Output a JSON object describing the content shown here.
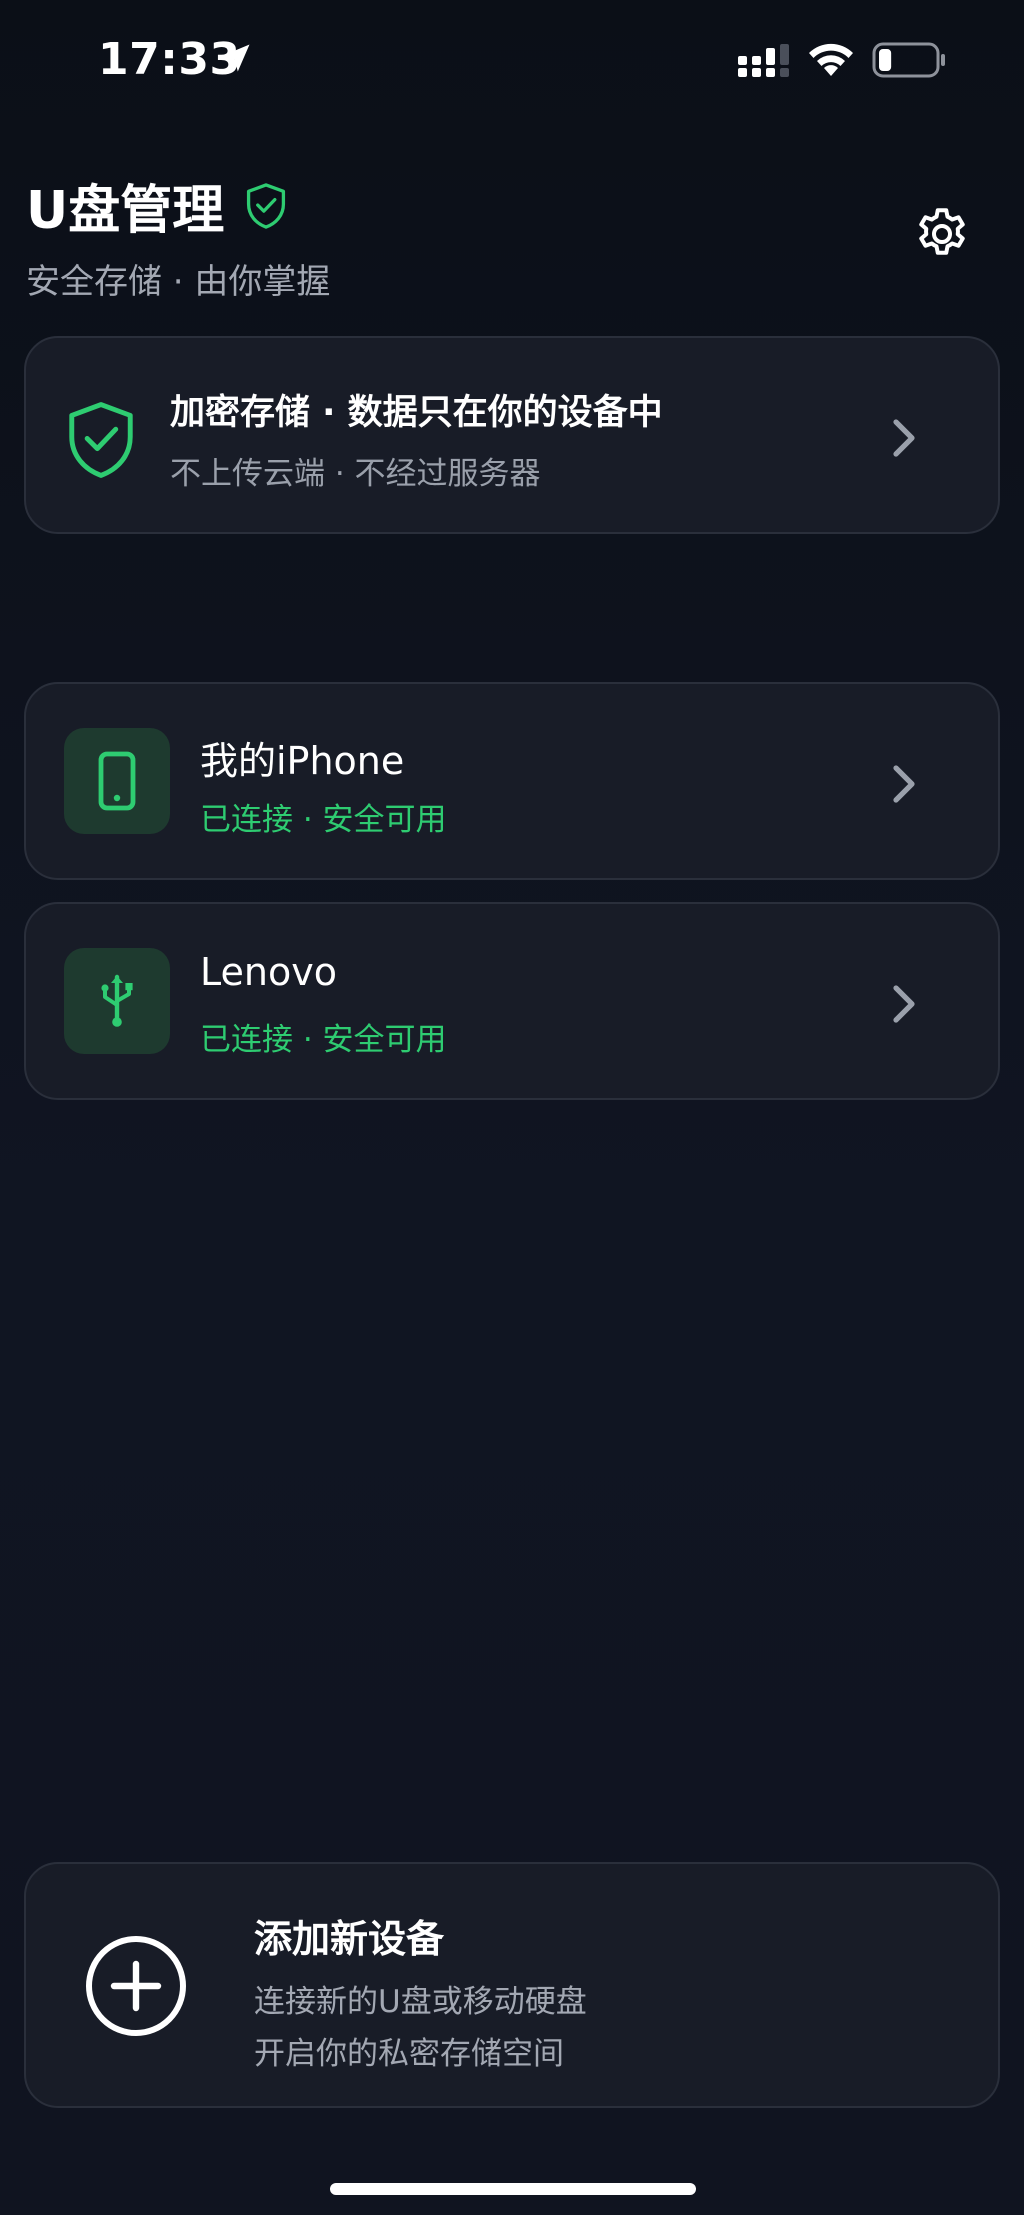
{
  "status_bar": {
    "time": "17:33",
    "icons": [
      "location-arrow-icon",
      "cellular-signal-icon",
      "wifi-icon",
      "battery-icon"
    ],
    "battery_level": 0.15
  },
  "header": {
    "title": "U盘管理",
    "subtitle": "安全存储 · 由你掌握",
    "title_icon": "shield-check-icon",
    "settings_icon": "gear-icon"
  },
  "security_banner": {
    "title": "加密存储 · 数据只在你的设备中",
    "subtitle": "不上传云端 · 不经过服务器",
    "icon": "shield-check-icon"
  },
  "devices": [
    {
      "name": "我的iPhone",
      "status": "已连接 · 安全可用",
      "icon": "phone-icon"
    },
    {
      "name": "Lenovo",
      "status": "已连接 · 安全可用",
      "icon": "usb-icon"
    }
  ],
  "add_device": {
    "title": "添加新设备",
    "line1": "连接新的U盘或移动硬盘",
    "line2": "开启你的私密存储空间",
    "icon": "plus-circle-icon"
  },
  "colors": {
    "accent_green": "#2ecc71",
    "background": "#0b0f17",
    "card": "#181c27",
    "icon_box": "#1e3a2f"
  }
}
